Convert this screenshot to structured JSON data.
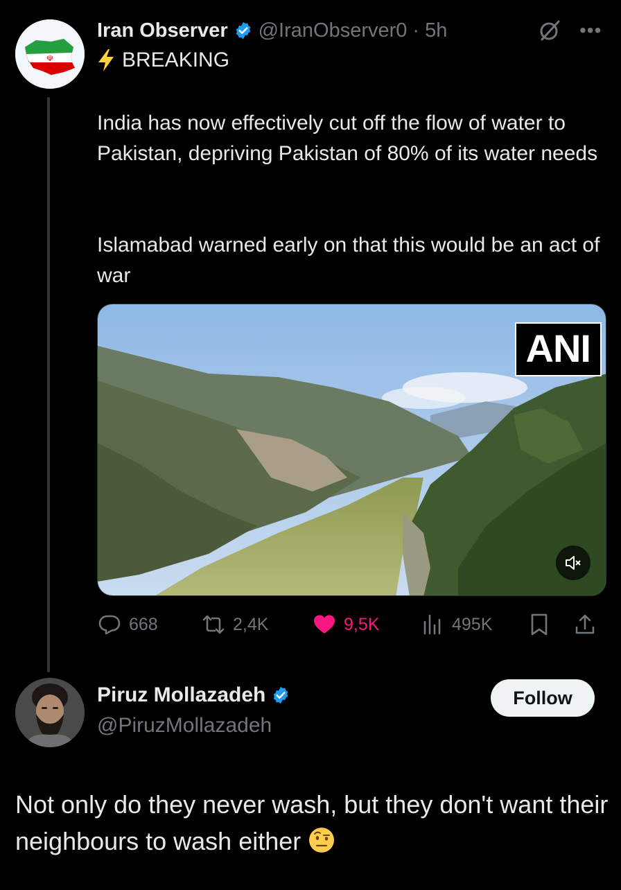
{
  "post": {
    "author": {
      "display_name": "Iran Observer",
      "handle": "@IranObserver0",
      "verified": true
    },
    "separator": "·",
    "timestamp": "5h",
    "label_icon": "lightning-bolt",
    "label": "BREAKING",
    "paragraphs": [
      "India has now effectively cut off the flow of water to Pakistan, depriving Pakistan of 80% of its water needs",
      "Islamabad warned early on that this would be an act of war"
    ],
    "media": {
      "watermark": "ANI",
      "type": "video",
      "muted": true
    },
    "stats": {
      "replies": "668",
      "reposts": "2,4K",
      "likes": "9,5K",
      "views": "495K"
    },
    "liked": true,
    "colors": {
      "like": "#f91880",
      "verified": "#1d9bf0",
      "muted_text": "#71767b"
    }
  },
  "reply": {
    "author": {
      "display_name": "Piruz Mollazadeh",
      "handle": "@PiruzMollazadeh",
      "verified": true
    },
    "follow_label": "Follow",
    "text": "Not only do they never wash, but they don't want their neighbours to wash either",
    "emoji": "face-with-raised-eyebrow"
  }
}
